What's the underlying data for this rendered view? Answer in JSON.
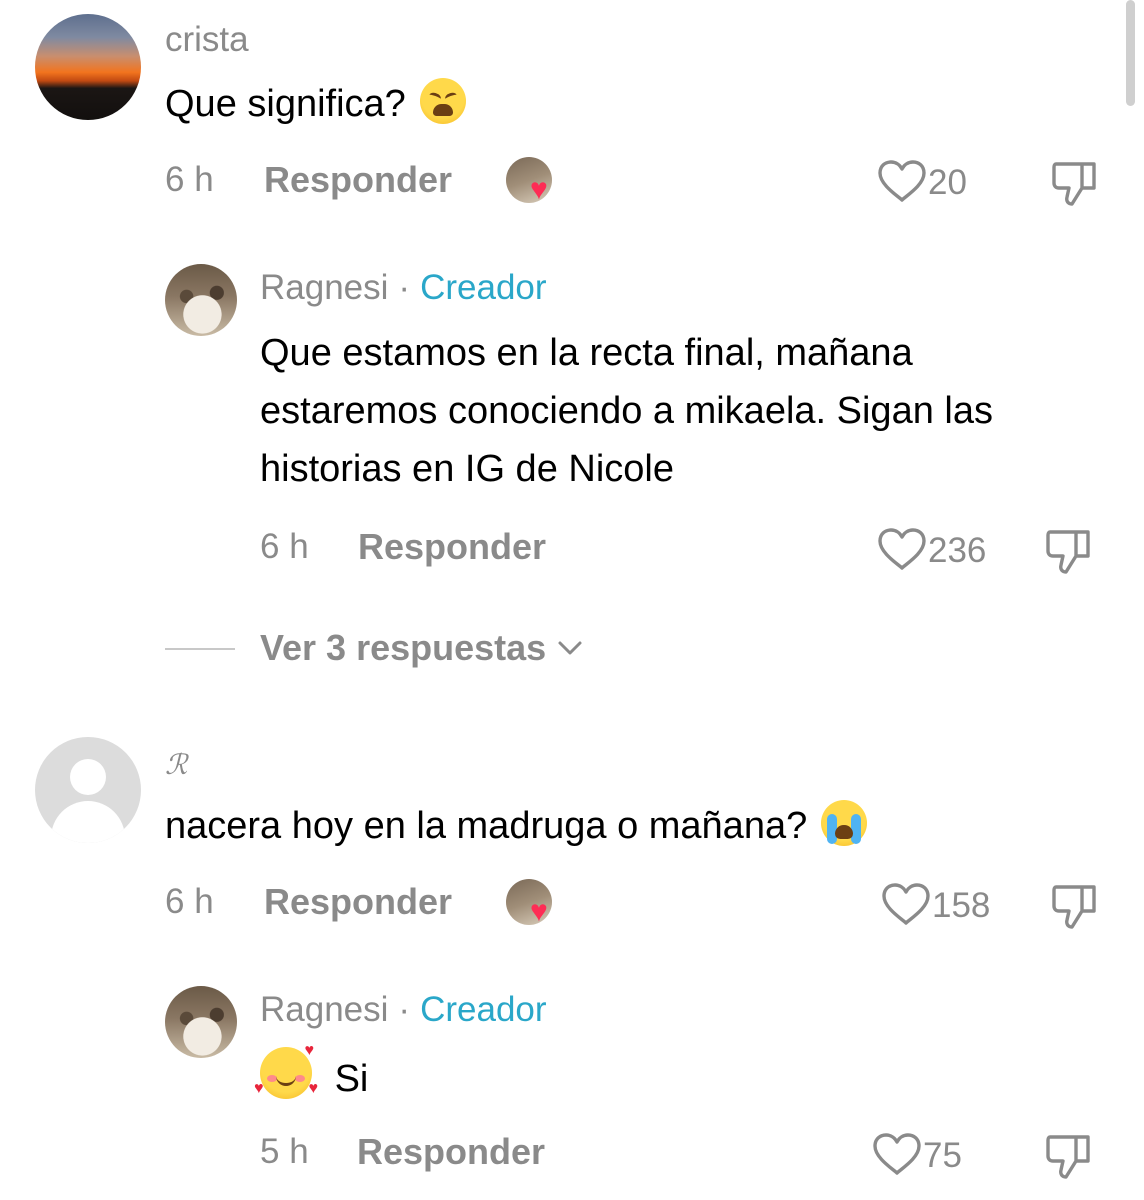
{
  "comments": [
    {
      "username": "crista",
      "text": "Que significa?",
      "emoji": "weary-face-emoji",
      "time": "6 h",
      "reply_label": "Responder",
      "creator_liked": true,
      "likes": "20"
    },
    {
      "username": "Ragnesi",
      "separator": "·",
      "badge": "Creador",
      "text": "Que estamos en la recta final, mañana estaremos conociendo a mikaela. Sigan las historias en IG de Nicole",
      "time": "6 h",
      "reply_label": "Responder",
      "likes": "236"
    },
    {
      "username": "ℛ",
      "text": "nacera hoy en la madruga o mañana?",
      "emoji": "loudly-crying-face-emoji",
      "time": "6 h",
      "reply_label": "Responder",
      "creator_liked": true,
      "likes": "158"
    },
    {
      "username": "Ragnesi",
      "separator": "·",
      "badge": "Creador",
      "text": "Si",
      "emoji": "smiling-face-with-hearts-emoji",
      "time": "5 h",
      "reply_label": "Responder",
      "likes": "75"
    }
  ],
  "view_replies_label": "Ver 3 respuestas",
  "icons": {
    "like": "heart-outline-icon",
    "dislike": "thumbs-down-icon",
    "expand": "chevron-down-icon",
    "creator_like": "creator-heart-icon"
  },
  "colors": {
    "creator_badge": "#2aa7c9",
    "secondary_text": "#8a8a8a",
    "heart_red": "#fe2c55"
  }
}
